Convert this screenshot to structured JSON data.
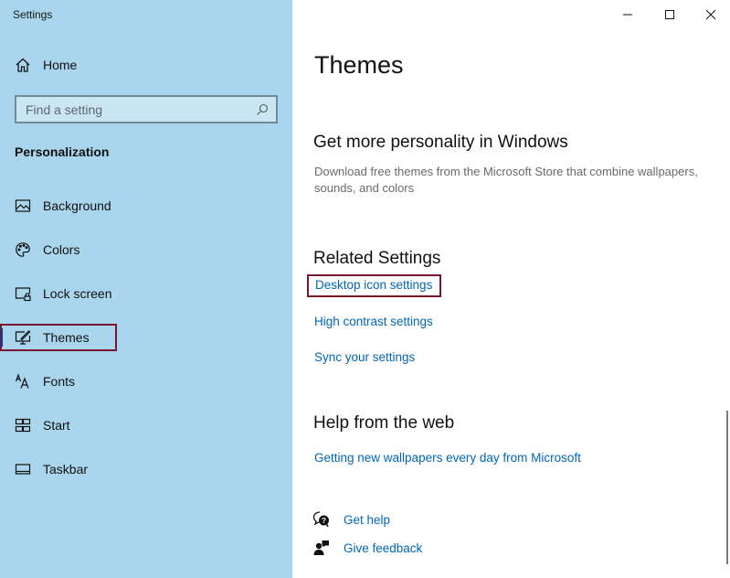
{
  "window": {
    "title": "Settings",
    "controls": {
      "minimize": "minimize-icon",
      "maximize": "maximize-icon",
      "close": "close-icon"
    }
  },
  "sidebar": {
    "home_label": "Home",
    "home_icon": "home-icon",
    "search_placeholder": "Find a setting",
    "search_value": "",
    "search_icon": "search-icon",
    "section_title": "Personalization",
    "items": [
      {
        "label": "Background",
        "icon": "picture-icon",
        "selected": false
      },
      {
        "label": "Colors",
        "icon": "palette-icon",
        "selected": false
      },
      {
        "label": "Lock screen",
        "icon": "lock-screen-icon",
        "selected": false
      },
      {
        "label": "Themes",
        "icon": "themes-brush-icon",
        "selected": true
      },
      {
        "label": "Fonts",
        "icon": "fonts-icon",
        "selected": false
      },
      {
        "label": "Start",
        "icon": "start-tiles-icon",
        "selected": false
      },
      {
        "label": "Taskbar",
        "icon": "taskbar-icon",
        "selected": false
      }
    ]
  },
  "main": {
    "title": "Themes",
    "personality": {
      "heading": "Get more personality in Windows",
      "description": "Download free themes from the Microsoft Store that combine wallpapers, sounds, and colors"
    },
    "related": {
      "heading": "Related Settings",
      "links": [
        "Desktop icon settings",
        "High contrast settings",
        "Sync your settings"
      ],
      "highlighted": "Desktop icon settings"
    },
    "web_help": {
      "heading": "Help from the web",
      "links": [
        "Getting new wallpapers every day from Microsoft"
      ]
    },
    "support": [
      {
        "label": "Get help",
        "icon": "get-help-icon"
      },
      {
        "label": "Give feedback",
        "icon": "feedback-icon"
      }
    ]
  },
  "colors": {
    "sidebar_bg": "#a9d6ec",
    "link": "#0067b8",
    "highlight_border": "#7a1530"
  }
}
